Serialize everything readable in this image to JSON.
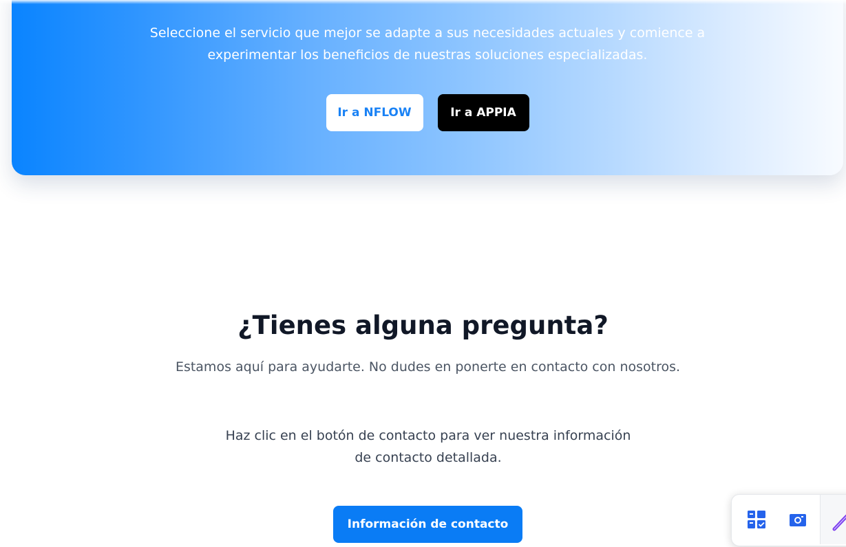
{
  "cta": {
    "title": "",
    "subtitle": "Seleccione el servicio que mejor se adapte a sus necesidades actuales y comience a experimentar los beneficios de nuestras soluciones especializadas.",
    "nflow_label": "Ir a NFLOW",
    "appia_label": "Ir a APPIA"
  },
  "contact": {
    "title": "¿Tienes alguna pregunta?",
    "subtitle": "Estamos aquí para ayudarte. No dudes en ponerte en contacto con nosotros.",
    "note": "Haz clic en el botón de contacto para ver nuestra información de contacto detallada.",
    "button_label": "Información de contacto"
  },
  "tray": {
    "icons": [
      "board-icon",
      "camera-icon",
      "pen-icon"
    ]
  },
  "colors": {
    "primary": "#0a7cf5",
    "gradient_start": "#0a84ff",
    "gradient_end": "#f8fbff",
    "heading": "#111827",
    "body_text": "#4b5563"
  }
}
